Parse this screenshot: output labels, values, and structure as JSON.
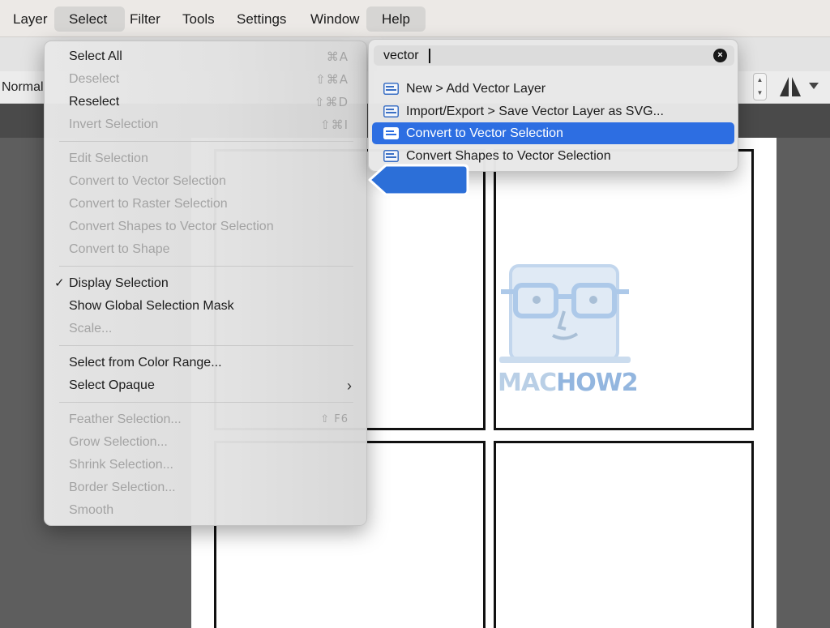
{
  "menubar": {
    "items": [
      "Layer",
      "Select",
      "Filter",
      "Tools",
      "Settings",
      "Window",
      "Help"
    ]
  },
  "options": {
    "blend_mode": "Normal"
  },
  "select_menu": {
    "group1": [
      {
        "label": "Select All",
        "shortcut": "⌘A",
        "disabled": false
      },
      {
        "label": "Deselect",
        "shortcut": "⇧⌘A",
        "disabled": true
      },
      {
        "label": "Reselect",
        "shortcut": "⇧⌘D",
        "disabled": false
      },
      {
        "label": "Invert Selection",
        "shortcut": "⇧⌘I",
        "disabled": true
      }
    ],
    "group2": [
      {
        "label": "Edit Selection",
        "disabled": true
      },
      {
        "label": "Convert to Vector Selection",
        "disabled": true
      },
      {
        "label": "Convert to Raster Selection",
        "disabled": true
      },
      {
        "label": "Convert Shapes to Vector Selection",
        "disabled": true
      },
      {
        "label": "Convert to Shape",
        "disabled": true
      }
    ],
    "group3": [
      {
        "label": "Display Selection",
        "checked": true,
        "check_mark": "✓",
        "disabled": false
      },
      {
        "label": "Show Global Selection Mask",
        "disabled": false
      },
      {
        "label": "Scale...",
        "disabled": true
      }
    ],
    "group4": [
      {
        "label": "Select from Color Range...",
        "disabled": false
      },
      {
        "label": "Select Opaque",
        "has_submenu": true,
        "chevron": "›",
        "disabled": false
      }
    ],
    "group5": [
      {
        "label": "Feather Selection...",
        "shortcut": "⇧ F6",
        "disabled": true
      },
      {
        "label": "Grow Selection...",
        "disabled": true
      },
      {
        "label": "Shrink Selection...",
        "disabled": true
      },
      {
        "label": "Border Selection...",
        "disabled": true
      },
      {
        "label": "Smooth",
        "disabled": true
      }
    ]
  },
  "help_search": {
    "query": "vector",
    "clear_glyph": "×",
    "results": [
      {
        "label": "New > Add Vector Layer",
        "active": false
      },
      {
        "label": "Import/Export > Save Vector Layer as SVG...",
        "active": false
      },
      {
        "label": "Convert to Vector Selection",
        "active": true
      },
      {
        "label": "Convert Shapes to Vector Selection",
        "active": false
      }
    ]
  },
  "watermark": {
    "text_a": "MAC",
    "text_b": "HOW2"
  },
  "colors": {
    "accent": "#2d6ee2",
    "callout": "#2c6fd8",
    "menubar_bg": "#ece9e6",
    "canvas_bg": "#5e5e5e"
  },
  "icons": {
    "mirror": "mirror-symmetry-icon",
    "dropdown": "triangle-down-icon",
    "result": "menu-item-icon"
  }
}
